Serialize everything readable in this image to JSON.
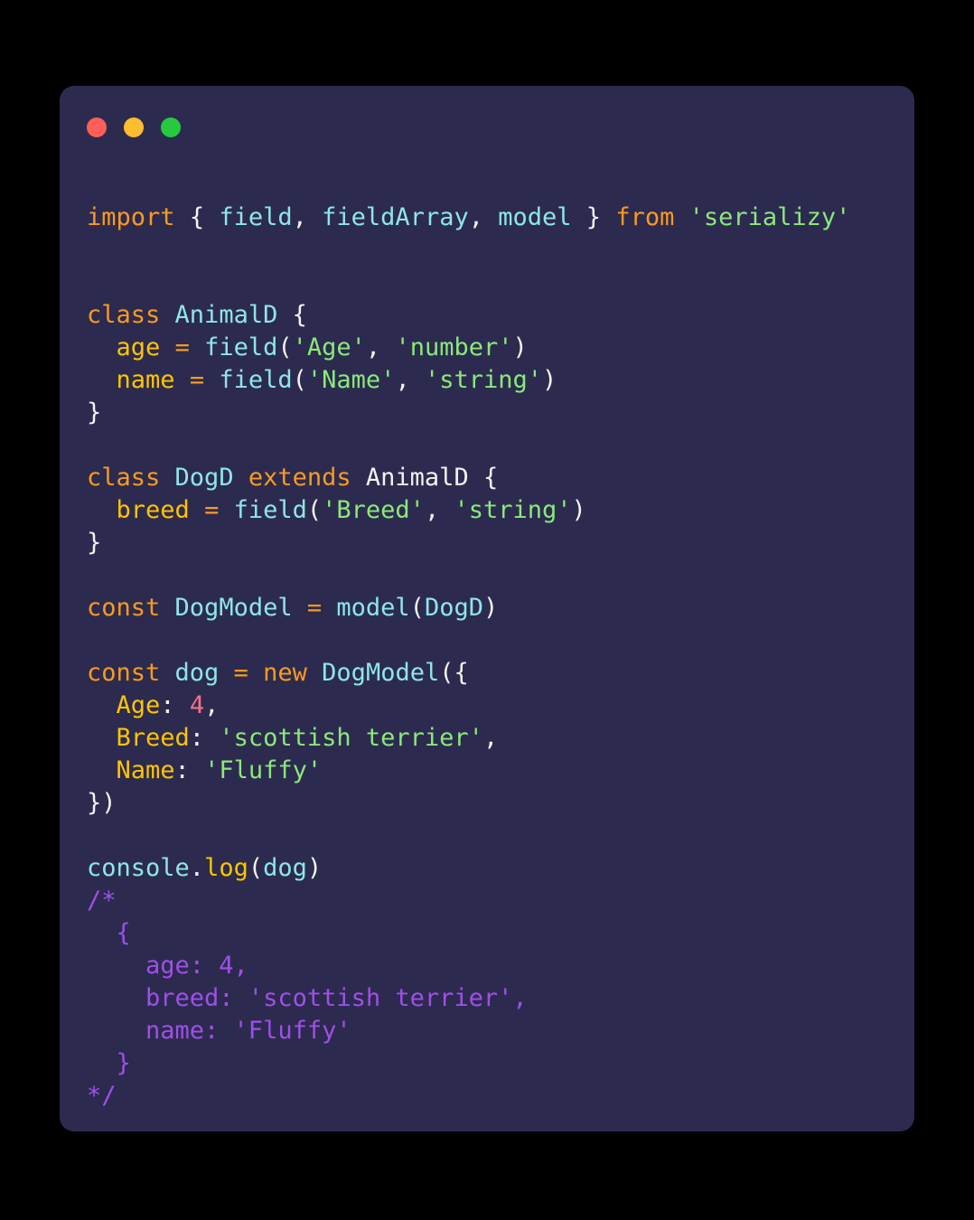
{
  "window": {
    "background_color": "#000000",
    "card_background_color": "#2C2B4F",
    "controls": [
      {
        "name": "close",
        "label": "close-dot",
        "color": "#FF5F56"
      },
      {
        "name": "minimize",
        "label": "minimize-dot",
        "color": "#FFBD2E"
      },
      {
        "name": "maximize",
        "label": "maximize-dot",
        "color": "#27C93F"
      }
    ]
  },
  "theme": {
    "keyword": "#F99A21",
    "entity": "#8FE6E6",
    "identifier": "#8FE6E6",
    "plain": "#F2F2F2",
    "string": "#8CE87A",
    "property": "#FFC400",
    "number": "#F9708A",
    "operator": "#F99A21",
    "function": "#FFC400",
    "comment": "#A04FE8"
  },
  "code": {
    "language": "javascript",
    "plain_text": "import { field, fieldArray, model } from 'serializy'\n\nclass AnimalD {\n  age = field('Age', 'number')\n  name = field('Name', 'string')\n}\n\nclass DogD extends AnimalD {\n  breed = field('Breed', 'string')\n}\n\nconst DogModel = model(DogD)\n\nconst dog = new DogModel({\n  Age: 4,\n  Breed: 'scottish terrier',\n  Name: 'Fluffy'\n})\n\nconsole.log(dog)\n/*\n  {\n    age: 4,\n    breed: 'scottish terrier',\n    name: 'Fluffy'\n  }\n*/",
    "lines": [
      {
        "n": 1,
        "tokens": [
          {
            "t": "import",
            "c": "keyword"
          },
          {
            "t": " ",
            "c": "plain"
          },
          {
            "t": "{",
            "c": "punct"
          },
          {
            "t": " ",
            "c": "plain"
          },
          {
            "t": "field",
            "c": "ident"
          },
          {
            "t": ",",
            "c": "punct"
          },
          {
            "t": " ",
            "c": "plain"
          },
          {
            "t": "fieldArray",
            "c": "ident"
          },
          {
            "t": ",",
            "c": "punct"
          },
          {
            "t": " ",
            "c": "plain"
          },
          {
            "t": "model",
            "c": "ident"
          },
          {
            "t": " ",
            "c": "plain"
          },
          {
            "t": "}",
            "c": "punct"
          },
          {
            "t": " ",
            "c": "plain"
          },
          {
            "t": "from",
            "c": "keyword"
          },
          {
            "t": " ",
            "c": "plain"
          },
          {
            "t": "'serializy'",
            "c": "string"
          }
        ]
      },
      {
        "n": 2,
        "tokens": []
      },
      {
        "n": 3,
        "tokens": []
      },
      {
        "n": 4,
        "tokens": [
          {
            "t": "class",
            "c": "keyword"
          },
          {
            "t": " ",
            "c": "plain"
          },
          {
            "t": "AnimalD",
            "c": "entity"
          },
          {
            "t": " ",
            "c": "plain"
          },
          {
            "t": "{",
            "c": "punct"
          }
        ]
      },
      {
        "n": 5,
        "tokens": [
          {
            "t": "  ",
            "c": "plain"
          },
          {
            "t": "age",
            "c": "property"
          },
          {
            "t": " ",
            "c": "plain"
          },
          {
            "t": "=",
            "c": "operator"
          },
          {
            "t": " ",
            "c": "plain"
          },
          {
            "t": "field",
            "c": "ident"
          },
          {
            "t": "(",
            "c": "punct"
          },
          {
            "t": "'Age'",
            "c": "string"
          },
          {
            "t": ",",
            "c": "punct"
          },
          {
            "t": " ",
            "c": "plain"
          },
          {
            "t": "'number'",
            "c": "string"
          },
          {
            "t": ")",
            "c": "punct"
          }
        ]
      },
      {
        "n": 6,
        "tokens": [
          {
            "t": "  ",
            "c": "plain"
          },
          {
            "t": "name",
            "c": "property"
          },
          {
            "t": " ",
            "c": "plain"
          },
          {
            "t": "=",
            "c": "operator"
          },
          {
            "t": " ",
            "c": "plain"
          },
          {
            "t": "field",
            "c": "ident"
          },
          {
            "t": "(",
            "c": "punct"
          },
          {
            "t": "'Name'",
            "c": "string"
          },
          {
            "t": ",",
            "c": "punct"
          },
          {
            "t": " ",
            "c": "plain"
          },
          {
            "t": "'string'",
            "c": "string"
          },
          {
            "t": ")",
            "c": "punct"
          }
        ]
      },
      {
        "n": 7,
        "tokens": [
          {
            "t": "}",
            "c": "punct"
          }
        ]
      },
      {
        "n": 8,
        "tokens": []
      },
      {
        "n": 9,
        "tokens": [
          {
            "t": "class",
            "c": "keyword"
          },
          {
            "t": " ",
            "c": "plain"
          },
          {
            "t": "DogD",
            "c": "entity"
          },
          {
            "t": " ",
            "c": "plain"
          },
          {
            "t": "extends",
            "c": "keyword"
          },
          {
            "t": " ",
            "c": "plain"
          },
          {
            "t": "AnimalD",
            "c": "plain"
          },
          {
            "t": " ",
            "c": "plain"
          },
          {
            "t": "{",
            "c": "punct"
          }
        ]
      },
      {
        "n": 10,
        "tokens": [
          {
            "t": "  ",
            "c": "plain"
          },
          {
            "t": "breed",
            "c": "property"
          },
          {
            "t": " ",
            "c": "plain"
          },
          {
            "t": "=",
            "c": "operator"
          },
          {
            "t": " ",
            "c": "plain"
          },
          {
            "t": "field",
            "c": "ident"
          },
          {
            "t": "(",
            "c": "punct"
          },
          {
            "t": "'Breed'",
            "c": "string"
          },
          {
            "t": ",",
            "c": "punct"
          },
          {
            "t": " ",
            "c": "plain"
          },
          {
            "t": "'string'",
            "c": "string"
          },
          {
            "t": ")",
            "c": "punct"
          }
        ]
      },
      {
        "n": 11,
        "tokens": [
          {
            "t": "}",
            "c": "punct"
          }
        ]
      },
      {
        "n": 12,
        "tokens": []
      },
      {
        "n": 13,
        "tokens": [
          {
            "t": "const",
            "c": "keyword"
          },
          {
            "t": " ",
            "c": "plain"
          },
          {
            "t": "DogModel",
            "c": "entity"
          },
          {
            "t": " ",
            "c": "plain"
          },
          {
            "t": "=",
            "c": "operator"
          },
          {
            "t": " ",
            "c": "plain"
          },
          {
            "t": "model",
            "c": "ident"
          },
          {
            "t": "(",
            "c": "punct"
          },
          {
            "t": "DogD",
            "c": "ident"
          },
          {
            "t": ")",
            "c": "punct"
          }
        ]
      },
      {
        "n": 14,
        "tokens": []
      },
      {
        "n": 15,
        "tokens": [
          {
            "t": "const",
            "c": "keyword"
          },
          {
            "t": " ",
            "c": "plain"
          },
          {
            "t": "dog",
            "c": "ident"
          },
          {
            "t": " ",
            "c": "plain"
          },
          {
            "t": "=",
            "c": "operator"
          },
          {
            "t": " ",
            "c": "plain"
          },
          {
            "t": "new",
            "c": "keyword"
          },
          {
            "t": " ",
            "c": "plain"
          },
          {
            "t": "DogModel",
            "c": "entity"
          },
          {
            "t": "(",
            "c": "punct"
          },
          {
            "t": "{",
            "c": "punct"
          }
        ]
      },
      {
        "n": 16,
        "tokens": [
          {
            "t": "  ",
            "c": "plain"
          },
          {
            "t": "Age",
            "c": "property"
          },
          {
            "t": ":",
            "c": "punct"
          },
          {
            "t": " ",
            "c": "plain"
          },
          {
            "t": "4",
            "c": "number"
          },
          {
            "t": ",",
            "c": "punct"
          }
        ]
      },
      {
        "n": 17,
        "tokens": [
          {
            "t": "  ",
            "c": "plain"
          },
          {
            "t": "Breed",
            "c": "property"
          },
          {
            "t": ":",
            "c": "punct"
          },
          {
            "t": " ",
            "c": "plain"
          },
          {
            "t": "'scottish terrier'",
            "c": "string"
          },
          {
            "t": ",",
            "c": "punct"
          }
        ]
      },
      {
        "n": 18,
        "tokens": [
          {
            "t": "  ",
            "c": "plain"
          },
          {
            "t": "Name",
            "c": "property"
          },
          {
            "t": ":",
            "c": "punct"
          },
          {
            "t": " ",
            "c": "plain"
          },
          {
            "t": "'Fluffy'",
            "c": "string"
          }
        ]
      },
      {
        "n": 19,
        "tokens": [
          {
            "t": "}",
            "c": "punct"
          },
          {
            "t": ")",
            "c": "punct"
          }
        ]
      },
      {
        "n": 20,
        "tokens": []
      },
      {
        "n": 21,
        "tokens": [
          {
            "t": "console",
            "c": "ident"
          },
          {
            "t": ".",
            "c": "punct"
          },
          {
            "t": "log",
            "c": "function"
          },
          {
            "t": "(",
            "c": "punct"
          },
          {
            "t": "dog",
            "c": "ident"
          },
          {
            "t": ")",
            "c": "punct"
          }
        ]
      },
      {
        "n": 22,
        "tokens": [
          {
            "t": "/*",
            "c": "comment"
          }
        ]
      },
      {
        "n": 23,
        "tokens": [
          {
            "t": "  {",
            "c": "comment"
          }
        ]
      },
      {
        "n": 24,
        "tokens": [
          {
            "t": "    age: 4,",
            "c": "comment"
          }
        ]
      },
      {
        "n": 25,
        "tokens": [
          {
            "t": "    breed: 'scottish terrier',",
            "c": "comment"
          }
        ]
      },
      {
        "n": 26,
        "tokens": [
          {
            "t": "    name: 'Fluffy'",
            "c": "comment"
          }
        ]
      },
      {
        "n": 27,
        "tokens": [
          {
            "t": "  }",
            "c": "comment"
          }
        ]
      },
      {
        "n": 28,
        "tokens": [
          {
            "t": "*/",
            "c": "comment"
          }
        ]
      }
    ]
  }
}
